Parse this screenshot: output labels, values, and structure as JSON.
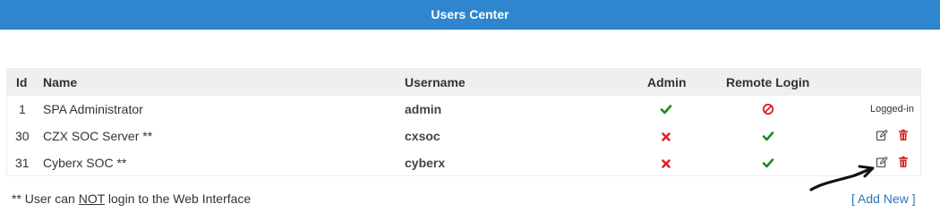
{
  "header": {
    "title": "Users Center"
  },
  "table": {
    "columns": {
      "id": "Id",
      "name": "Name",
      "username": "Username",
      "admin": "Admin",
      "remote_login": "Remote Login"
    },
    "rows": [
      {
        "id": "1",
        "name": "SPA Administrator",
        "username": "admin",
        "admin": "check-icon",
        "remote_login": "forbidden-icon",
        "status": "Logged-in"
      },
      {
        "id": "30",
        "name": "CZX SOC Server **",
        "username": "cxsoc",
        "admin": "cross-icon",
        "remote_login": "check-icon",
        "actions": [
          "edit-icon",
          "delete-icon"
        ]
      },
      {
        "id": "31",
        "name": "Cyberx SOC **",
        "username": "cyberx",
        "admin": "cross-icon",
        "remote_login": "check-icon",
        "actions": [
          "edit-icon",
          "delete-icon"
        ]
      }
    ]
  },
  "footer": {
    "note_prefix": "** User can ",
    "note_emphasis": "NOT",
    "note_suffix": " login to the Web Interface",
    "add_new": "[ Add New ]"
  },
  "colors": {
    "header_bg": "#2f86cf",
    "check": "#1c8a1c",
    "cross": "#e02020",
    "delete": "#d42020",
    "link": "#2f75b8"
  }
}
